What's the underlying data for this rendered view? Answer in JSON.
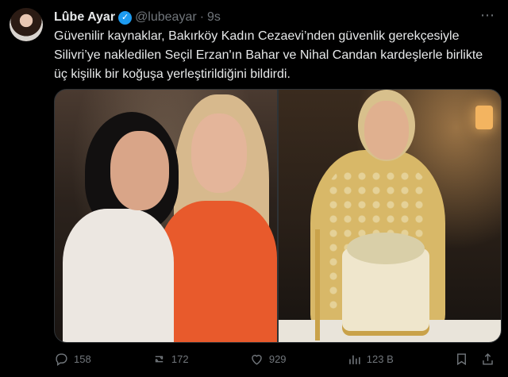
{
  "author": {
    "name": "Lûbe Ayar",
    "handle": "@lubeayar",
    "separator": "·",
    "time": "9s",
    "verified_mark": "✓"
  },
  "post": {
    "text": "Güvenilir kaynaklar, Bakırköy Kadın Cezaevi’nden güvenlik gerekçesiyle Silivri’ye nakledilen Seçil Erzan'ın Bahar ve Nihal Candan kardeşlerle birlikte üç kişilik bir koğuşa yerleştirildiğini bildirdi."
  },
  "metrics": {
    "replies": "158",
    "reposts": "172",
    "likes": "929",
    "views": "123 B"
  },
  "icons": {
    "more": "more-icon",
    "reply": "reply-icon",
    "repost": "repost-icon",
    "like": "heart-icon",
    "views": "views-icon",
    "bookmark": "bookmark-icon",
    "share": "share-icon"
  },
  "colors": {
    "background": "#000000",
    "text": "#e7e9ea",
    "muted": "#71767b",
    "verified": "#1d9bf0"
  }
}
